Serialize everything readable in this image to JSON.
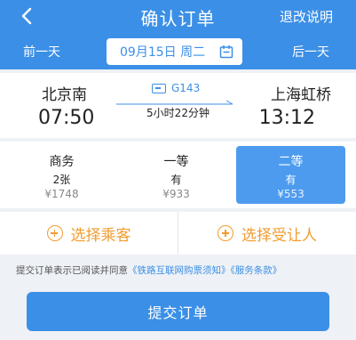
{
  "header": {
    "title": "确认订单",
    "refund_link": "退改说明",
    "prev_day": "前一天",
    "next_day": "后一天",
    "date": "09月15日 周二",
    "back_icon": "chevron-left-icon",
    "calendar_icon": "calendar-icon"
  },
  "train": {
    "from_station": "北京南",
    "to_station": "上海虹桥",
    "departure_time": "07:50",
    "arrival_time": "13:12",
    "train_number": "G143",
    "duration": "5小时22分钟"
  },
  "seats": [
    {
      "name": "商务",
      "count": "2张",
      "price": "¥1748",
      "selected": false
    },
    {
      "name": "一等",
      "count": "有",
      "price": "¥933",
      "selected": false
    },
    {
      "name": "二等",
      "count": "有",
      "price": "¥553",
      "selected": true
    }
  ],
  "actions": {
    "select_passenger": "选择乘客",
    "select_beneficiary": "选择受让人"
  },
  "agreement": {
    "prefix": "提交订单表示已阅读并同意",
    "link1": "《铁路互联网购票须知》",
    "link2": "《服务条款》"
  },
  "submit": {
    "label": "提交订单"
  },
  "colors": {
    "primary": "#3b8fe6",
    "accent": "#f29c2f",
    "selected_seat": "#4c9bef"
  }
}
